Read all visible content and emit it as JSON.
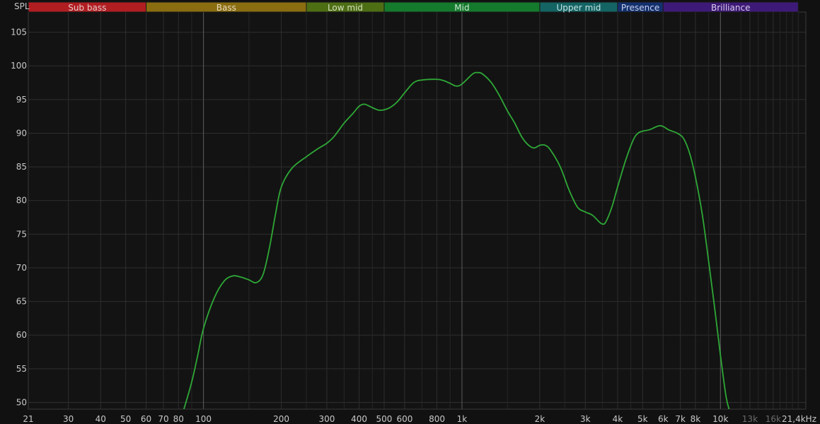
{
  "chart_data": {
    "type": "line",
    "ylabel": "SPL",
    "xlabel": "",
    "x_scale": "log",
    "xlim": [
      21,
      21400
    ],
    "ylim": [
      49,
      108
    ],
    "y_ticks": [
      50,
      55,
      60,
      65,
      70,
      75,
      80,
      85,
      90,
      95,
      100,
      105
    ],
    "x_ticks": [
      {
        "value": 21,
        "label": "21",
        "dim": false
      },
      {
        "value": 30,
        "label": "30",
        "dim": false
      },
      {
        "value": 40,
        "label": "40",
        "dim": false
      },
      {
        "value": 50,
        "label": "50",
        "dim": false
      },
      {
        "value": 60,
        "label": "60",
        "dim": false
      },
      {
        "value": 70,
        "label": "70",
        "dim": false
      },
      {
        "value": 80,
        "label": "80",
        "dim": false
      },
      {
        "value": 100,
        "label": "100",
        "dim": false
      },
      {
        "value": 200,
        "label": "200",
        "dim": false
      },
      {
        "value": 300,
        "label": "300",
        "dim": false
      },
      {
        "value": 400,
        "label": "400",
        "dim": false
      },
      {
        "value": 500,
        "label": "500",
        "dim": false
      },
      {
        "value": 600,
        "label": "600",
        "dim": false
      },
      {
        "value": 800,
        "label": "800",
        "dim": false
      },
      {
        "value": 1000,
        "label": "1k",
        "dim": false
      },
      {
        "value": 2000,
        "label": "2k",
        "dim": false
      },
      {
        "value": 3000,
        "label": "3k",
        "dim": false
      },
      {
        "value": 4000,
        "label": "4k",
        "dim": false
      },
      {
        "value": 5000,
        "label": "5k",
        "dim": false
      },
      {
        "value": 6000,
        "label": "6k",
        "dim": false
      },
      {
        "value": 7000,
        "label": "7k",
        "dim": false
      },
      {
        "value": 8000,
        "label": "8k",
        "dim": false
      },
      {
        "value": 10000,
        "label": "10k",
        "dim": false
      },
      {
        "value": 13000,
        "label": "13k",
        "dim": true
      },
      {
        "value": 16000,
        "label": "16k",
        "dim": true
      },
      {
        "value": 21400,
        "label": "21,4kHz",
        "dim": false
      }
    ],
    "minor_grid_x": [
      90,
      150,
      250,
      350,
      450,
      700,
      900,
      1500,
      2500,
      3500,
      4500,
      9000,
      12000,
      14000,
      15000,
      17000,
      18000,
      19000,
      20000
    ],
    "major_grid_x": [
      100,
      1000,
      10000
    ],
    "bands": [
      {
        "name": "Sub bass",
        "from": 21,
        "to": 60,
        "color": "#b01e22",
        "text_color": "#e8c8c8"
      },
      {
        "name": "Bass",
        "from": 60,
        "to": 250,
        "color": "#8a6d10",
        "text_color": "#e8dcc0"
      },
      {
        "name": "Low mid",
        "from": 250,
        "to": 500,
        "color": "#4e6e14",
        "text_color": "#d4e2c0"
      },
      {
        "name": "Mid",
        "from": 500,
        "to": 2000,
        "color": "#147a2c",
        "text_color": "#cfe6d4"
      },
      {
        "name": "Upper mid",
        "from": 2000,
        "to": 4000,
        "color": "#146464",
        "text_color": "#c8e2e2"
      },
      {
        "name": "Presence",
        "from": 4000,
        "to": 6000,
        "color": "#14306e",
        "text_color": "#c8d2ec"
      },
      {
        "name": "Brilliance",
        "from": 6000,
        "to": 20000,
        "color": "#3e1a78",
        "text_color": "#d8cceb"
      }
    ],
    "series": [
      {
        "color": "#2ea836",
        "points": [
          [
            84,
            49
          ],
          [
            90,
            53
          ],
          [
            95,
            57
          ],
          [
            100,
            61
          ],
          [
            110,
            65.5
          ],
          [
            120,
            68
          ],
          [
            130,
            68.8
          ],
          [
            140,
            68.6
          ],
          [
            150,
            68.2
          ],
          [
            160,
            67.8
          ],
          [
            170,
            69
          ],
          [
            180,
            73
          ],
          [
            190,
            78
          ],
          [
            200,
            82
          ],
          [
            220,
            84.8
          ],
          [
            250,
            86.5
          ],
          [
            280,
            87.8
          ],
          [
            300,
            88.5
          ],
          [
            320,
            89.5
          ],
          [
            350,
            91.5
          ],
          [
            380,
            93
          ],
          [
            400,
            94
          ],
          [
            420,
            94.3
          ],
          [
            450,
            93.8
          ],
          [
            480,
            93.4
          ],
          [
            520,
            93.7
          ],
          [
            560,
            94.6
          ],
          [
            600,
            96
          ],
          [
            650,
            97.5
          ],
          [
            700,
            97.9
          ],
          [
            800,
            98
          ],
          [
            850,
            97.8
          ],
          [
            900,
            97.4
          ],
          [
            950,
            97
          ],
          [
            1000,
            97.3
          ],
          [
            1100,
            98.8
          ],
          [
            1150,
            99
          ],
          [
            1200,
            98.8
          ],
          [
            1300,
            97.5
          ],
          [
            1400,
            95.5
          ],
          [
            1500,
            93.3
          ],
          [
            1600,
            91.5
          ],
          [
            1700,
            89.5
          ],
          [
            1800,
            88.3
          ],
          [
            1900,
            87.8
          ],
          [
            2000,
            88.2
          ],
          [
            2100,
            88.2
          ],
          [
            2200,
            87.5
          ],
          [
            2400,
            85
          ],
          [
            2600,
            81.5
          ],
          [
            2800,
            79
          ],
          [
            3000,
            78.3
          ],
          [
            3200,
            77.8
          ],
          [
            3400,
            76.8
          ],
          [
            3500,
            76.5
          ],
          [
            3600,
            76.8
          ],
          [
            3800,
            79
          ],
          [
            4000,
            82
          ],
          [
            4300,
            86
          ],
          [
            4600,
            89
          ],
          [
            4800,
            90
          ],
          [
            5000,
            90.3
          ],
          [
            5300,
            90.5
          ],
          [
            5600,
            90.9
          ],
          [
            5800,
            91.1
          ],
          [
            6000,
            91
          ],
          [
            6300,
            90.5
          ],
          [
            6800,
            90
          ],
          [
            7200,
            89.2
          ],
          [
            7600,
            87
          ],
          [
            8000,
            83.5
          ],
          [
            8500,
            78
          ],
          [
            9000,
            71
          ],
          [
            9500,
            64
          ],
          [
            10000,
            57
          ],
          [
            10500,
            51
          ],
          [
            10800,
            49
          ]
        ]
      }
    ]
  }
}
